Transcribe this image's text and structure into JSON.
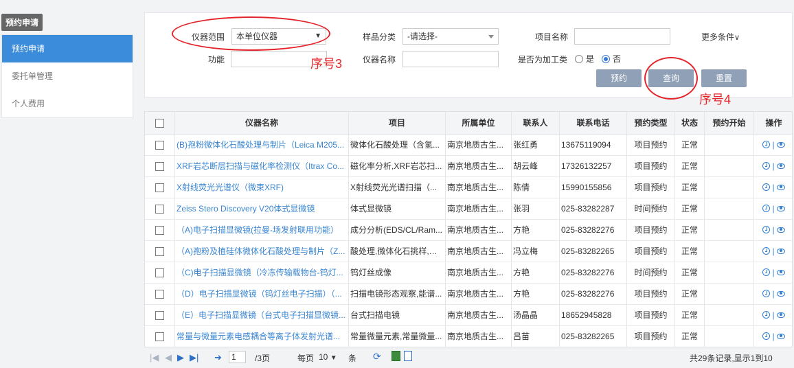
{
  "sidebar": {
    "title": "预约申请",
    "items": [
      {
        "label": "预约申请",
        "active": true
      },
      {
        "label": "委托单管理",
        "active": false
      },
      {
        "label": "个人费用",
        "active": false
      }
    ]
  },
  "filters": {
    "range_label": "仪器范围",
    "range_value": "本单位仪器",
    "sample_label": "样品分类",
    "sample_value": "-请选择-",
    "project_label": "项目名称",
    "project_value": "",
    "more_label": "更多条件",
    "function_label": "功能",
    "function_value": "",
    "instrument_label": "仪器名称",
    "instrument_value": "",
    "processing_label": "是否为加工类",
    "yes_label": "是",
    "no_label": "否",
    "selected": "否"
  },
  "buttons": {
    "reserve": "预约",
    "query": "查询",
    "reset": "重置"
  },
  "annotations": {
    "step3": "序号3",
    "step4": "序号4"
  },
  "table": {
    "headers": [
      "仪器名称",
      "项目",
      "所属单位",
      "联系人",
      "联系电话",
      "预约类型",
      "状态",
      "预约开始",
      "操作"
    ],
    "rows": [
      {
        "name": "(B)孢粉微体化石酸处理与制片（Leica M205...",
        "project": "微体化石酸处理（含氢...",
        "unit": "南京地质古生...",
        "contact": "张红勇",
        "phone": "13675119094",
        "type": "项目预约",
        "status": "正常",
        "start": ""
      },
      {
        "name": "XRF岩芯断层扫描与磁化率检测仪（Itrax Co...",
        "project": "磁化率分析,XRF岩芯扫...",
        "unit": "南京地质古生...",
        "contact": "胡云峰",
        "phone": "17326132257",
        "type": "项目预约",
        "status": "正常",
        "start": ""
      },
      {
        "name": "X射线荧光光谱仪（微束XRF)",
        "project": "X射线荧光光谱扫描（...",
        "unit": "南京地质古生...",
        "contact": "陈倩",
        "phone": "15990155856",
        "type": "项目预约",
        "status": "正常",
        "start": ""
      },
      {
        "name": "Zeiss Stero Discovery V20体式显微镜",
        "project": "体式显微镜",
        "unit": "南京地质古生...",
        "contact": "张羽",
        "phone": "025-83282287",
        "type": "时间预约",
        "status": "正常",
        "start": ""
      },
      {
        "name": "（A)电子扫描显微镜(拉曼-场发射联用功能）",
        "project": "成分分析(EDS/CL/Ram...",
        "unit": "南京地质古生...",
        "contact": "方艳",
        "phone": "025-83282276",
        "type": "项目预约",
        "status": "正常",
        "start": ""
      },
      {
        "name": "（A)孢粉及植硅体微体化石酸处理与制片（Z...",
        "project": "酸处理,微体化石挑样,微...",
        "unit": "南京地质古生...",
        "contact": "冯立梅",
        "phone": "025-83282265",
        "type": "项目预约",
        "status": "正常",
        "start": ""
      },
      {
        "name": "（C)电子扫描显微镜（冷冻传输载物台-钨灯...",
        "project": "钨灯丝成像",
        "unit": "南京地质古生...",
        "contact": "方艳",
        "phone": "025-83282276",
        "type": "时间预约",
        "status": "正常",
        "start": ""
      },
      {
        "name": "（D）电子扫描显微镜（钨灯丝电子扫描）（...",
        "project": "扫描电镜形态观察,能谱...",
        "unit": "南京地质古生...",
        "contact": "方艳",
        "phone": "025-83282276",
        "type": "项目预约",
        "status": "正常",
        "start": ""
      },
      {
        "name": "（E）电子扫描显微镜（台式电子扫描显微镜...",
        "project": "台式扫描电镜",
        "unit": "南京地质古生...",
        "contact": "汤晶晶",
        "phone": "18652945828",
        "type": "项目预约",
        "status": "正常",
        "start": ""
      },
      {
        "name": "常量与微量元素电感耦合等离子体发射光谱...",
        "project": "常量微量元素,常量微量...",
        "unit": "南京地质古生...",
        "contact": "吕苗",
        "phone": "025-83282265",
        "type": "项目预约",
        "status": "正常",
        "start": ""
      }
    ]
  },
  "pager": {
    "page_input": "1",
    "total_pages": "/3页",
    "per_page_label": "每页",
    "per_page_value": "10",
    "unit": "条",
    "summary": "共29条记录,显示1到10"
  }
}
